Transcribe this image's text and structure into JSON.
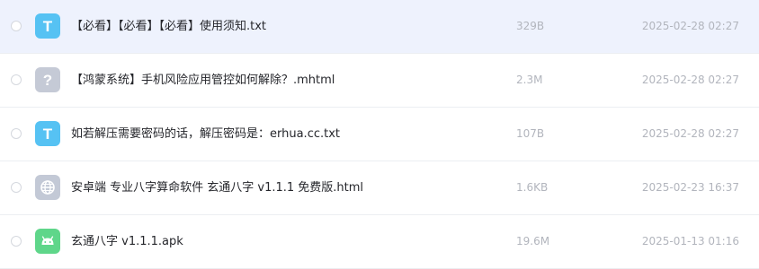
{
  "files": [
    {
      "name": "【必看】【必看】【必看】使用须知.txt",
      "size": "329B",
      "date": "2025-02-28 02:27",
      "icon": "text-file-icon",
      "icon_letter": "T",
      "icon_color": "#56c2f3"
    },
    {
      "name": "【鸿蒙系统】手机风险应用管控如何解除？.mhtml",
      "size": "2.3M",
      "date": "2025-02-28 02:27",
      "icon": "unknown-file-icon",
      "icon_letter": "?",
      "icon_color": "#c5cad6"
    },
    {
      "name": "如若解压需要密码的话，解压密码是：erhua.cc.txt",
      "size": "107B",
      "date": "2025-02-28 02:27",
      "icon": "text-file-icon",
      "icon_letter": "T",
      "icon_color": "#56c2f3"
    },
    {
      "name": "安卓端 专业八字算命软件 玄通八字 v1.1.1 免费版.html",
      "size": "1.6KB",
      "date": "2025-02-23 16:37",
      "icon": "web-file-icon",
      "icon_color": "#c3c9d6"
    },
    {
      "name": "玄通八字 v1.1.1.apk",
      "size": "19.6M",
      "date": "2025-01-13 01:16",
      "icon": "android-file-icon",
      "icon_color": "#5fd68a"
    }
  ]
}
